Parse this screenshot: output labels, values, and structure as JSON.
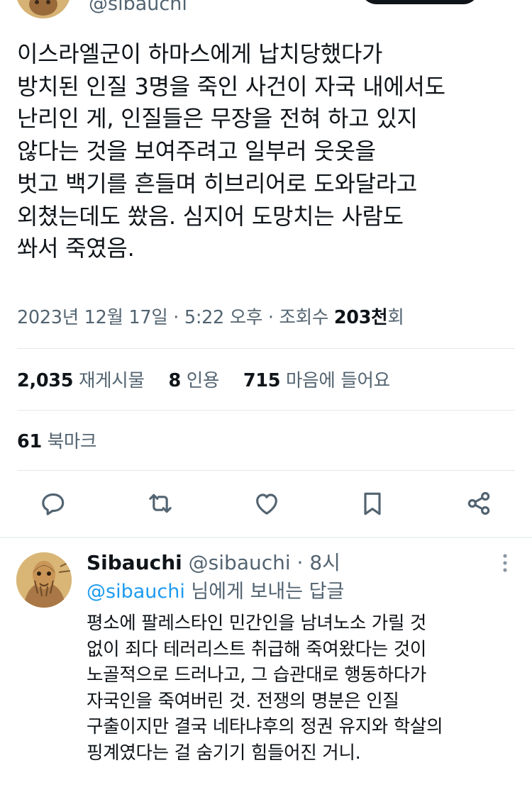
{
  "top": {
    "handle": "@sibauchi"
  },
  "tweet": {
    "text": "이스라엘군이 하마스에게 납치당했다가\n방치된 인질 3명을 죽인 사건이 자국 내에서도\n난리인 게, 인질들은 무장을 전혀 하고 있지\n않다는 것을 보여주려고 일부러 웃옷을\n벗고 백기를 흔들며 히브리어로 도와달라고\n외쳤는데도 쐈음. 심지어 도망치는 사람도\n쏴서 죽였음.",
    "date": "2023년 12월 17일",
    "time": "5:22 오후",
    "views_label": "조회수",
    "views_num": "203천",
    "views_suffix": "회",
    "retweets": "2,035",
    "retweets_label": "재게시물",
    "quotes": "8",
    "quotes_label": "인용",
    "likes": "715",
    "likes_label": "마음에 들어요",
    "bookmarks": "61",
    "bookmarks_label": "북마크"
  },
  "reply": {
    "name": "Sibauchi",
    "handle": "@sibauchi",
    "time": "8시",
    "replying_to": "@sibauchi",
    "replying_suffix": "님에게 보내는 답글",
    "text": "평소에 팔레스타인 민간인을 남녀노소 가릴 것\n없이 죄다 테러리스트 취급해 죽여왔다는 것이\n노골적으로 드러나고, 그 습관대로 행동하다가\n자국인을 죽여버린 것. 전쟁의 명분은 인질\n구출이지만 결국 네타냐후의 정권 유지와 학살의\n핑계였다는 걸 숨기기 힘들어진 거니."
  },
  "icons": [
    "reply-icon",
    "retweet-icon",
    "like-icon",
    "bookmark-icon",
    "share-icon",
    "more-icon"
  ],
  "colors": {
    "text": "#0f1419",
    "secondary": "#536471",
    "link": "#1d9bf0",
    "divider": "#e3e7ea"
  }
}
